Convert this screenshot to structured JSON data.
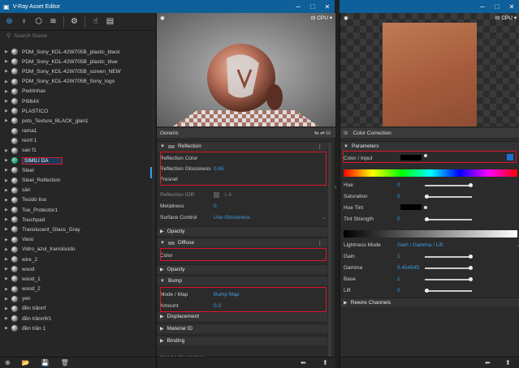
{
  "window": {
    "title": "V-Ray Asset Editor",
    "controls": [
      "─",
      "☐",
      "✕"
    ]
  },
  "left": {
    "search_placeholder": "Search Scene",
    "items": [
      {
        "label": "PDM_Sony_KDL-42W705B_plastic_black"
      },
      {
        "label": "PDM_Sony_KDL-42W705B_plastic_blue"
      },
      {
        "label": "PDM_Sony_KDL-42W705B_screen_NEW"
      },
      {
        "label": "PDM_Sony_KDL-42W705B_Sony_logo"
      },
      {
        "label": "Pedrinhas"
      },
      {
        "label": "PI964X"
      },
      {
        "label": "PLASTICO"
      },
      {
        "label": "pots_Texture_BLACK_glan1"
      },
      {
        "label": "rama1"
      },
      {
        "label": "remf 1"
      },
      {
        "label": "san f1"
      },
      {
        "label": "SIMILI DA",
        "selected": true
      },
      {
        "label": "Steel"
      },
      {
        "label": "Steel_Reflection"
      },
      {
        "label": "sàn"
      },
      {
        "label": "Tecido liso"
      },
      {
        "label": "Toe_Protector1"
      },
      {
        "label": "Touchpad"
      },
      {
        "label": "Translucent_Glass_Gray"
      },
      {
        "label": "Vaso"
      },
      {
        "label": "Vidro_azul_translúcido"
      },
      {
        "label": "wire_2"
      },
      {
        "label": "wood"
      },
      {
        "label": "wood_1"
      },
      {
        "label": "wood_2"
      },
      {
        "label": "yen"
      },
      {
        "label": "đền trầnnf"
      },
      {
        "label": "đền trầnnf#1"
      },
      {
        "label": "đền trần 1"
      }
    ]
  },
  "preview": {
    "cpu_label": "CPU"
  },
  "props": {
    "header": "Generic",
    "reflection": {
      "title": "Reflection",
      "color_label": "Reflection Color",
      "gloss_label": "Reflection Glossiness",
      "gloss_value": "0.65",
      "fresnel_label": "Fresnel",
      "ior_label": "Reflection IOR",
      "ior_value": "1.6",
      "metal_label": "Metalness",
      "metal_value": "0",
      "surface_label": "Surface Control",
      "surface_value": "Use Glossiness"
    },
    "opacity1": "Opacity",
    "diffuse": {
      "title": "Diffuse",
      "color_label": "Color"
    },
    "opacity2": "Opacity",
    "bump": {
      "title": "Bump",
      "mode_label": "Mode / Map",
      "mode_value": "Bump Map",
      "amount_label": "Amount",
      "amount_value": "0.3"
    },
    "displacement": "Displacement",
    "material_id": "Material ID",
    "binding": "Binding",
    "can_be_overridden": "Can be Overridden"
  },
  "right": {
    "cpu_label": "CPU",
    "header": "Color Correction",
    "section": "Parameters",
    "color_input": "Color / Input",
    "hue": "Hue",
    "hue_value": "0",
    "saturation": "Saturation",
    "saturation_value": "0",
    "hue_tint": "Hue Tint",
    "tint_strength": "Tint Strength",
    "tint_strength_value": "0",
    "lightness_mode": "Lightness Mode",
    "lightness_value": "Gain / Gamma / Lift",
    "gain": "Gain",
    "gain_value": "1",
    "gamma": "Gamma",
    "gamma_value": "0.454545",
    "base": "Base",
    "base_value": "1",
    "lift": "Lift",
    "lift_value": "0",
    "rewire": "Rewire Channels"
  },
  "colors": {
    "title_bar": "#0e5f9a",
    "accent": "#3aa0e8",
    "highlight_box": "#e0142c",
    "diffuse_color": "#2b2bff",
    "reflection_color": "#ffffff"
  }
}
